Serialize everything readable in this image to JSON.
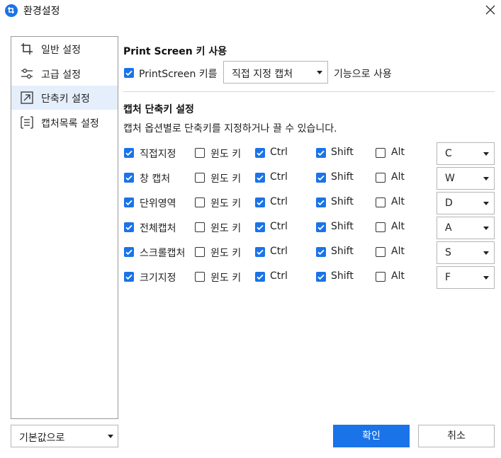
{
  "window": {
    "title": "환경설정"
  },
  "sidebar": {
    "items": [
      {
        "label": "일반 설정",
        "icon": "crop-icon"
      },
      {
        "label": "고급 설정",
        "icon": "sliders-icon"
      },
      {
        "label": "단축키 설정",
        "icon": "shortcut-arrow-icon",
        "active": true
      },
      {
        "label": "캡처목록 설정",
        "icon": "capture-list-icon"
      }
    ]
  },
  "print_screen": {
    "title": "Print Screen 키 사용",
    "checkbox_label": "PrintScreen 키를",
    "checked": true,
    "mode_value": "직접 지정 캡처",
    "suffix": "기능으로 사용"
  },
  "shortcuts": {
    "title": "캡처 단축키 설정",
    "description": "캡처 옵션별로 단축키를 지정하거나 끌 수 있습니다.",
    "modifier_labels": {
      "win": "윈도 키",
      "ctrl": "Ctrl",
      "shift": "Shift",
      "alt": "Alt"
    },
    "rows": [
      {
        "name": "직접지정",
        "enabled": true,
        "win": false,
        "ctrl": true,
        "shift": true,
        "alt": false,
        "key": "C"
      },
      {
        "name": "창 캡처",
        "enabled": true,
        "win": false,
        "ctrl": true,
        "shift": true,
        "alt": false,
        "key": "W"
      },
      {
        "name": "단위영역",
        "enabled": true,
        "win": false,
        "ctrl": true,
        "shift": true,
        "alt": false,
        "key": "D"
      },
      {
        "name": "전체캡처",
        "enabled": true,
        "win": false,
        "ctrl": true,
        "shift": true,
        "alt": false,
        "key": "A"
      },
      {
        "name": "스크롤캡처",
        "enabled": true,
        "win": false,
        "ctrl": true,
        "shift": true,
        "alt": false,
        "key": "S"
      },
      {
        "name": "크기지정",
        "enabled": true,
        "win": false,
        "ctrl": true,
        "shift": true,
        "alt": false,
        "key": "F"
      }
    ]
  },
  "footer": {
    "defaults_value": "기본값으로",
    "ok_label": "확인",
    "cancel_label": "취소"
  },
  "colors": {
    "accent": "#1a73e8",
    "active_bg": "#e5eefb",
    "border": "#9a9a9a"
  }
}
